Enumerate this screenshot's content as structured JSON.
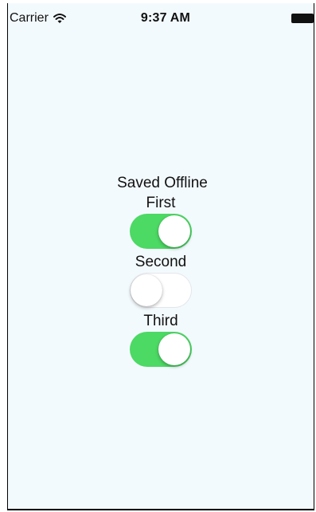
{
  "status_bar": {
    "carrier": "Carrier",
    "time": "9:37 AM",
    "icons": [
      "wifi-icon",
      "battery-icon"
    ]
  },
  "main": {
    "title": "Saved Offline",
    "toggles": [
      {
        "label": "First",
        "on": true
      },
      {
        "label": "Second",
        "on": false
      },
      {
        "label": "Third",
        "on": true
      }
    ]
  },
  "colors": {
    "switch_on": "#4cd964",
    "background": "#f3fafe"
  }
}
